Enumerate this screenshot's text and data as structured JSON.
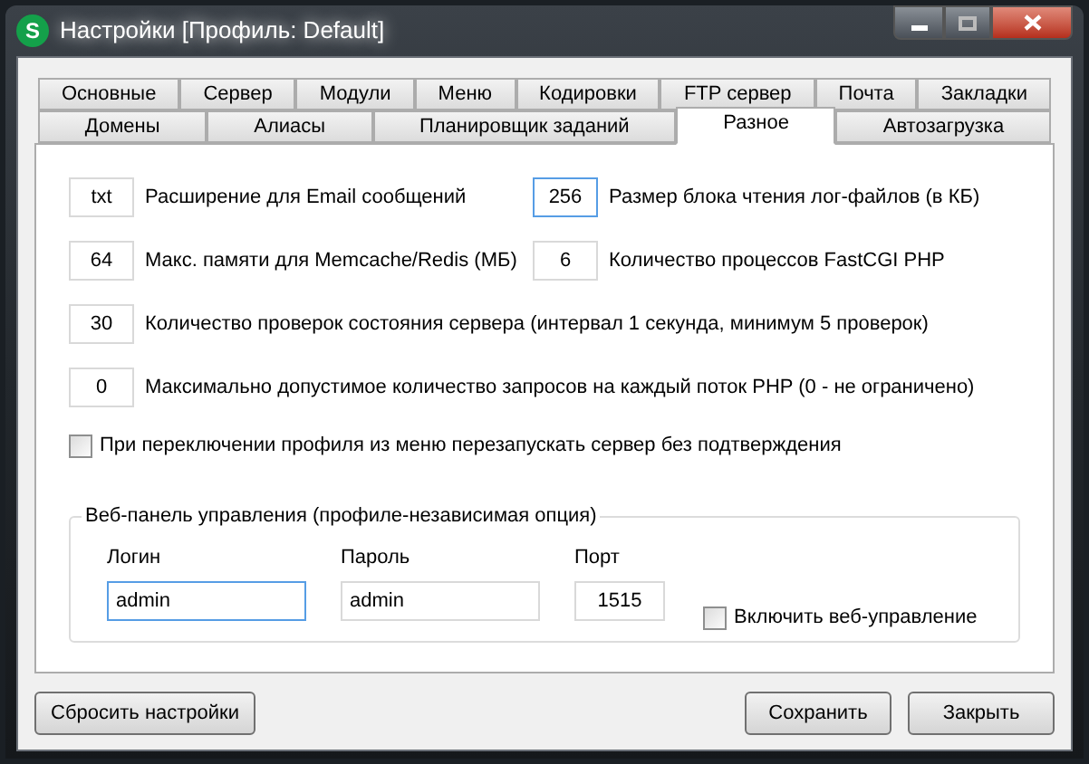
{
  "window": {
    "title": "Настройки [Профиль: Default]",
    "app_icon": "S"
  },
  "tabs": [
    [
      {
        "label": "Основные",
        "selected": false
      },
      {
        "label": "Сервер",
        "selected": false
      },
      {
        "label": "Модули",
        "selected": false
      },
      {
        "label": "Меню",
        "selected": false
      },
      {
        "label": "Кодировки",
        "selected": false
      },
      {
        "label": "FTP сервер",
        "selected": false
      },
      {
        "label": "Почта",
        "selected": false
      },
      {
        "label": "Закладки",
        "selected": false
      }
    ],
    [
      {
        "label": "Домены",
        "selected": false
      },
      {
        "label": "Алиасы",
        "selected": false
      },
      {
        "label": "Планировщик заданий",
        "selected": false
      },
      {
        "label": "Разное",
        "selected": true
      },
      {
        "label": "Автозагрузка",
        "selected": false
      }
    ]
  ],
  "settings": [
    [
      {
        "value": "txt",
        "label": "Расширение для Email сообщений",
        "focused": false
      },
      {
        "value": "256",
        "label": "Размер блока чтения лог-файлов (в КБ)",
        "focused": true
      }
    ],
    [
      {
        "value": "64",
        "label": "Макс. памяти для Memcache/Redis (МБ)",
        "focused": false
      },
      {
        "value": "6",
        "label": "Количество процессов FastCGI PHP",
        "focused": false
      }
    ],
    [
      {
        "value": "30",
        "label": "Количество проверок состояния сервера (интервал 1 секунда, минимум 5 проверок)",
        "focused": false
      }
    ],
    [
      {
        "value": "0",
        "label": "Максимально допустимое количество запросов на каждый поток PHP (0 - не ограничено)",
        "focused": false
      }
    ]
  ],
  "restart_checkbox": {
    "label": "При переключении профиля из меню перезапускать сервер без подтверждения",
    "checked": false
  },
  "web_panel": {
    "title": "Веб-панель управления (профиле-независимая опция)",
    "fields": [
      {
        "label": "Логин",
        "value": "admin",
        "focused": true
      },
      {
        "label": "Пароль",
        "value": "admin",
        "focused": false
      },
      {
        "label": "Порт",
        "value": "1515",
        "focused": false
      }
    ],
    "enable_checkbox": {
      "label": "Включить веб-управление",
      "checked": false
    }
  },
  "buttons": {
    "left": [
      "Сбросить настройки"
    ],
    "right": [
      "Сохранить",
      "Закрыть"
    ]
  }
}
